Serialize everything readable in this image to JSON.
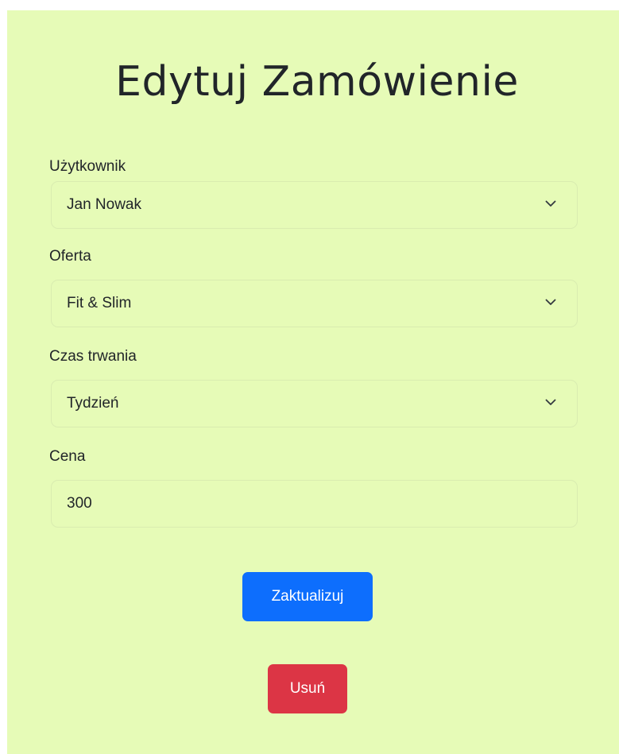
{
  "page": {
    "title": "Edytuj Zamówienie"
  },
  "form": {
    "user": {
      "label": "Użytkownik",
      "value": "Jan Nowak"
    },
    "offer": {
      "label": "Oferta",
      "value": "Fit & Slim"
    },
    "duration": {
      "label": "Czas trwania",
      "value": "Tydzień"
    },
    "price": {
      "label": "Cena",
      "value": "300"
    }
  },
  "actions": {
    "update_label": "Zaktualizuj",
    "delete_label": "Usuń"
  },
  "colors": {
    "background": "#e6fbb7",
    "primary": "#0d6efd",
    "danger": "#dc3545"
  },
  "icons": {
    "select_indicator": "chevron-down-icon"
  }
}
